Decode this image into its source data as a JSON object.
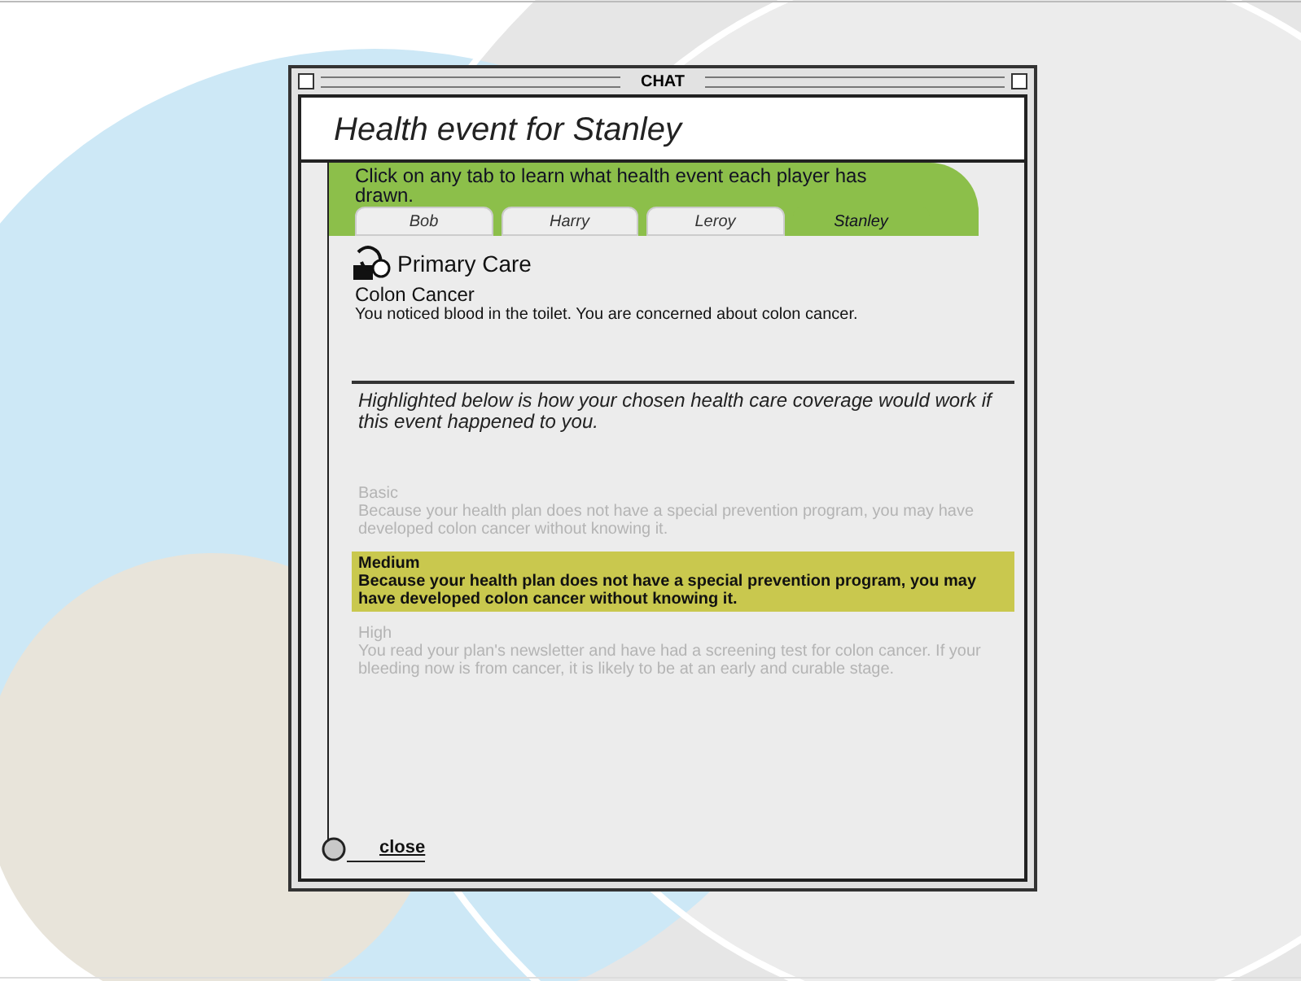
{
  "window": {
    "title": "CHAT"
  },
  "heading": "Health event for Stanley",
  "instruction": "Click on any tab to learn what health event each player has drawn.",
  "tabs": [
    {
      "label": "Bob",
      "selected": false
    },
    {
      "label": "Harry",
      "selected": false
    },
    {
      "label": "Leroy",
      "selected": false
    },
    {
      "label": "Stanley",
      "selected": true
    }
  ],
  "event": {
    "category": "Primary Care",
    "title": "Colon Cancer",
    "description": "You noticed blood in the toilet. You are concerned about colon cancer."
  },
  "coverage_intro": "Highlighted below is how your chosen health care coverage would work if this event happened to you.",
  "coverage_options": [
    {
      "level_name": "Basic",
      "text": "Because your health plan does not have a special prevention program, you may have developed colon cancer without knowing it.",
      "selected": false
    },
    {
      "level_name": "Medium",
      "text": "Because your health plan does not have a special prevention program, you may have developed colon cancer without knowing it.",
      "selected": true
    },
    {
      "level_name": "High",
      "text": "You read your plan's newsletter and have had a screening test for colon cancer. If your bleeding now is from cancer, it is likely to be at an early and curable stage.",
      "selected": false
    }
  ],
  "close_label": "close"
}
